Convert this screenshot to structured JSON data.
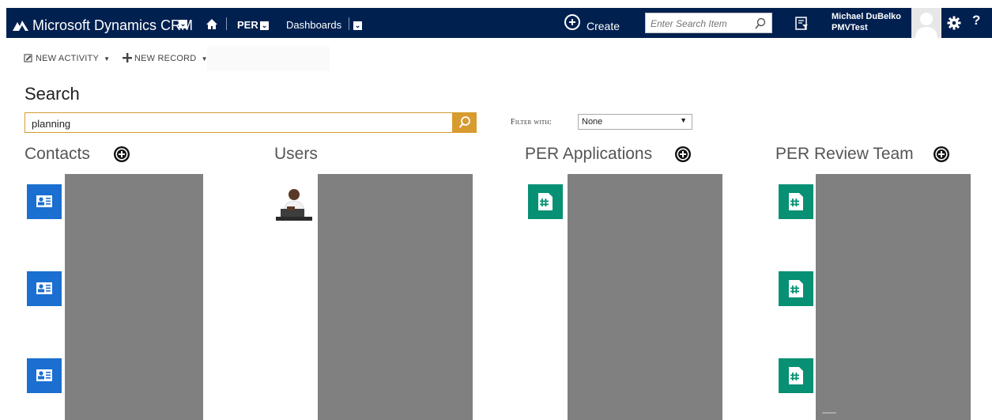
{
  "topbar": {
    "brand": "Microsoft Dynamics CRM",
    "area": "PER",
    "section": "Dashboards",
    "create_label": "Create",
    "search_placeholder": "Enter Search Item",
    "user_name": "Michael DuBelko",
    "user_org": "PMVTest",
    "help": "?",
    "icons": [
      "logo-icon",
      "chevron-down-icon",
      "home-icon",
      "plus-circle-icon",
      "search-icon",
      "advanced-find-icon",
      "avatar",
      "gear-icon",
      "help-icon"
    ],
    "colors": {
      "bar": "#002050",
      "text": "#ffffff"
    }
  },
  "commandbar": {
    "new_activity": "NEW ACTIVITY",
    "new_record": "NEW RECORD"
  },
  "search": {
    "title": "Search",
    "query": "planning",
    "filter_label": "Filter with:",
    "filter_value": "None",
    "accent": "#d79b30"
  },
  "columns": [
    {
      "title": "Contacts",
      "tile_color": "#1a6fd0",
      "results": 3
    },
    {
      "title": "Users",
      "results": 1
    },
    {
      "title": "PER Applications",
      "tile_color": "#079074",
      "results": 1
    },
    {
      "title": "PER Review Team",
      "tile_color": "#079074",
      "results": 3
    }
  ]
}
